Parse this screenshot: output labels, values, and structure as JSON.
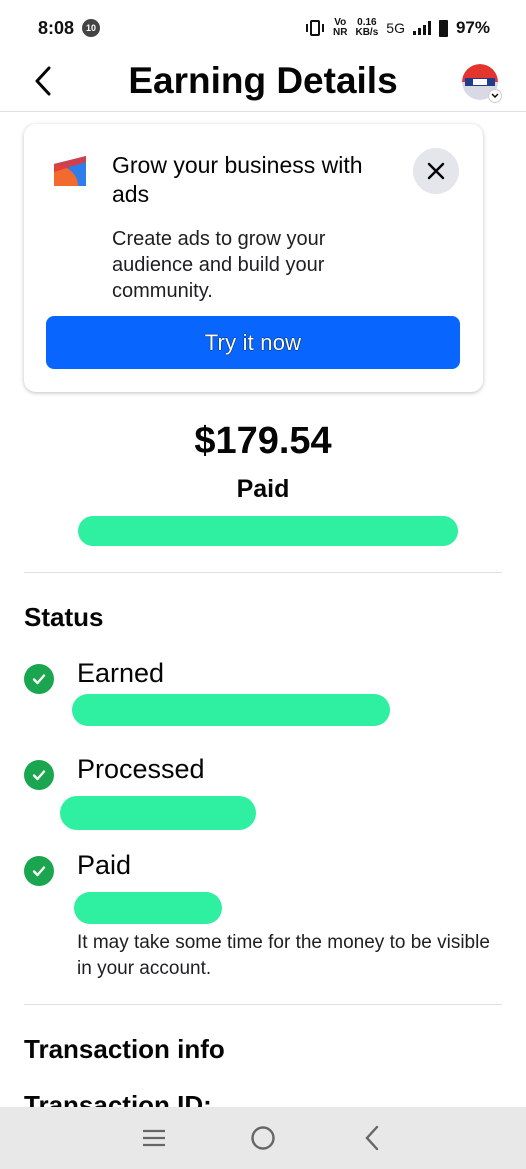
{
  "status_bar": {
    "time": "8:08",
    "notif_badge": "10",
    "vo_top": "Vo",
    "vo_bottom": "NR",
    "speed_top": "0.16",
    "speed_bottom": "KB/s",
    "network": "5G",
    "battery": "97%"
  },
  "header": {
    "title": "Earning Details",
    "back_icon": "chevron-left-icon",
    "avatar_icon": "profile-avatar"
  },
  "ad_card": {
    "title": "Grow your business with ads",
    "description": "Create ads to grow your audience and build your community.",
    "button_label": "Try it now",
    "icon": "ads-chart-icon",
    "close_icon": "close-icon"
  },
  "summary": {
    "amount": "$179.54",
    "status": "Paid"
  },
  "status_section": {
    "title": "Status",
    "items": [
      {
        "label": "Earned"
      },
      {
        "label": "Processed"
      },
      {
        "label": "Paid"
      }
    ],
    "note": "It may take some time for the money to be visible in your account."
  },
  "transaction": {
    "title": "Transaction info",
    "partial_label": "Transaction ID:"
  },
  "nav": {
    "menu_icon": "recent-apps-icon",
    "home_icon": "home-icon",
    "back_icon": "back-icon"
  },
  "colors": {
    "accent": "#0866ff",
    "success": "#1aa64f",
    "redaction": "#2ef0a0"
  }
}
